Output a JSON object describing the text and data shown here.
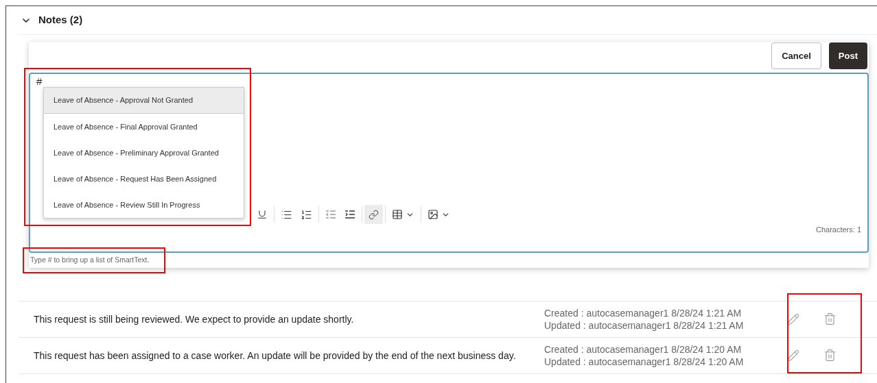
{
  "section": {
    "title": "Notes (2)",
    "expanded": true
  },
  "editor": {
    "buttons": [
      {
        "label": "Cancel",
        "kind": "secondary"
      },
      {
        "label": "Post",
        "kind": "primary"
      }
    ],
    "value": "#",
    "toolbar": [
      {
        "kind": "underline",
        "active": false,
        "has_menu": false
      },
      {
        "kind": "bullet-list",
        "active": false,
        "has_menu": false
      },
      {
        "kind": "numbered-list",
        "active": false,
        "has_menu": false
      },
      {
        "kind": "outdent",
        "active": false,
        "has_menu": false
      },
      {
        "kind": "indent",
        "active": false,
        "has_menu": false
      },
      {
        "kind": "link",
        "active": true,
        "has_menu": false
      },
      {
        "kind": "table",
        "active": false,
        "has_menu": true
      },
      {
        "kind": "image",
        "active": false,
        "has_menu": true
      }
    ],
    "character_count": "Characters: 1",
    "hint": "Type # to bring up a list of SmartText."
  },
  "smarttext_menu": [
    {
      "label": "Leave of Absence - Approval Not Granted",
      "selected": true
    },
    {
      "label": "Leave of Absence - Final Approval Granted",
      "selected": false
    },
    {
      "label": "Leave of Absence - Preliminary Approval Granted",
      "selected": false
    },
    {
      "label": "Leave of Absence - Request Has Been Assigned",
      "selected": false
    },
    {
      "label": "Leave of Absence - Review Still In Progress",
      "selected": false
    }
  ],
  "notes": [
    {
      "text": "This request is still being reviewed. We expect to provide an update shortly.",
      "created": "Created : autocasemanager1 8/28/24 1:21 AM",
      "updated": "Updated : autocasemanager1 8/28/24 1:21 AM"
    },
    {
      "text": "This request has been assigned to a case worker. An update will be provided by the end of the next business day.",
      "created": "Created : autocasemanager1 8/28/24 1:20 AM",
      "updated": "Updated : autocasemanager1 8/28/24 1:20 AM"
    }
  ]
}
